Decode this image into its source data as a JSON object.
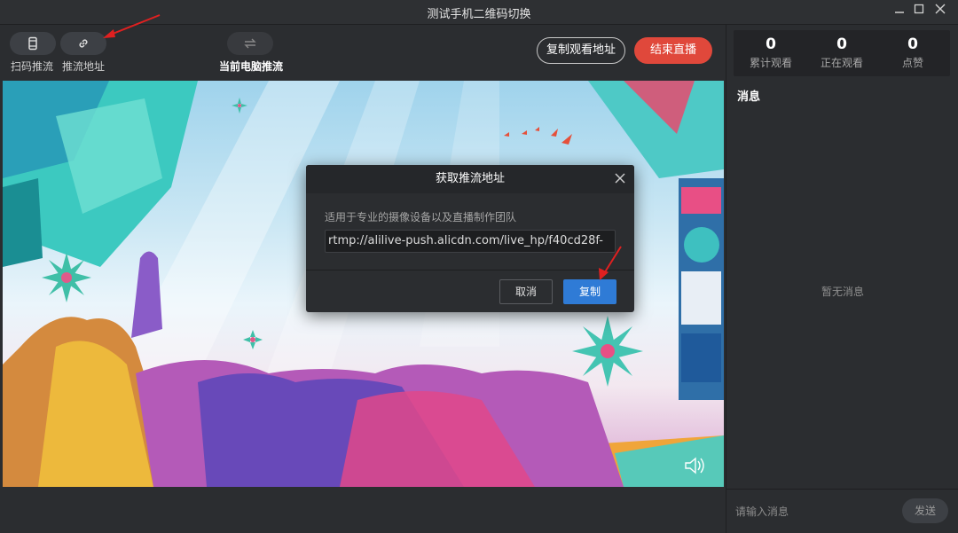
{
  "window": {
    "title": "测试手机二维码切换"
  },
  "toolbar": {
    "scan_label": "扫码推流",
    "push_url_label": "推流地址",
    "pc_push_label": "当前电脑推流",
    "copy_watch_label": "复制观看地址",
    "end_live_label": "结束直播"
  },
  "stats": {
    "total_views": "0",
    "total_views_label": "累计观看",
    "watching": "0",
    "watching_label": "正在观看",
    "likes": "0",
    "likes_label": "点赞"
  },
  "messages": {
    "title": "消息",
    "empty_text": "暂无消息",
    "input_placeholder": "请输入消息",
    "send_label": "发送"
  },
  "dialog": {
    "title": "获取推流地址",
    "description": "适用于专业的摄像设备以及直播制作团队",
    "url": "rtmp://alilive-push.alicdn.com/live_hp/f40cd28f-",
    "cancel_label": "取消",
    "copy_label": "复制"
  },
  "colors": {
    "accent_blue": "#2f7bd6",
    "end_red": "#e0483b",
    "annotation_arrow": "#e02020"
  },
  "icons": {
    "scan": "phone-icon",
    "push_url": "link-icon",
    "pc_push": "switch-arrows-icon",
    "volume": "volume-icon",
    "close": "close-icon"
  }
}
